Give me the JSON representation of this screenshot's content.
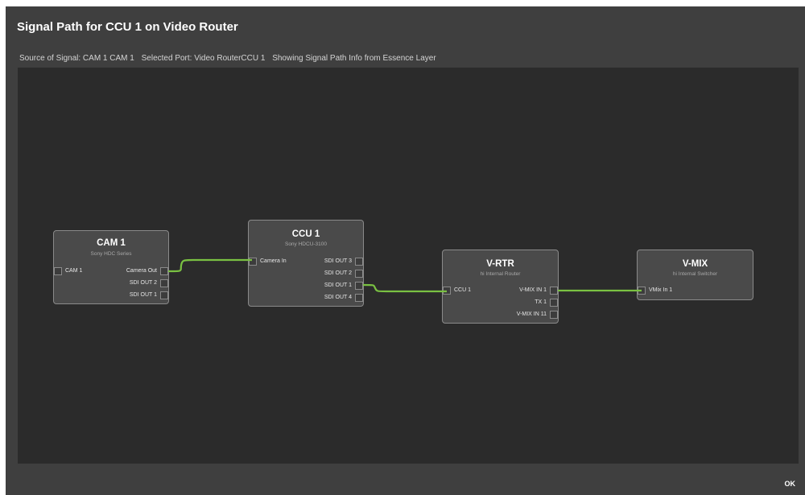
{
  "dialog": {
    "title": "Signal Path for CCU 1 on Video Router",
    "info": {
      "source": "Source of Signal: CAM 1 CAM 1",
      "port": "Selected Port: Video RouterCCU 1",
      "layer": "Showing Signal Path Info from Essence Layer"
    },
    "ok_label": "OK"
  },
  "nodes": {
    "cam1": {
      "title": "CAM 1",
      "subtitle": "Sony HDC Series",
      "inputs": [
        "CAM 1"
      ],
      "outputs": [
        "Camera Out",
        "SDI OUT 2",
        "SDI OUT 1"
      ]
    },
    "ccu1": {
      "title": "CCU 1",
      "subtitle": "Sony HDCU-3100",
      "inputs": [
        "Camera In"
      ],
      "outputs": [
        "SDI OUT 3",
        "SDI OUT 2",
        "SDI OUT 1",
        "SDI OUT 4"
      ]
    },
    "vrtr": {
      "title": "V-RTR",
      "subtitle": "hi Internal Router",
      "inputs": [
        "CCU 1"
      ],
      "outputs": [
        "V-MIX IN 1",
        "TX 1",
        "V-MIX IN 11"
      ]
    },
    "vmix": {
      "title": "V-MIX",
      "subtitle": "hi Internal Switcher",
      "inputs": [
        "VMix In 1"
      ],
      "outputs": []
    }
  },
  "connections": [
    {
      "from": "CAM 1 Camera Out",
      "to": "CCU 1 Camera In"
    },
    {
      "from": "CCU 1 SDI OUT 1",
      "to": "V-RTR CCU 1"
    },
    {
      "from": "V-RTR V-MIX IN 1",
      "to": "V-MIX VMix In 1"
    }
  ],
  "colors": {
    "dialog_bg": "#3f3f3f",
    "canvas_bg": "#2b2b2b",
    "node_bg": "#4a4a4a",
    "node_border": "#8a8a8a",
    "wire": "#7ac142"
  }
}
